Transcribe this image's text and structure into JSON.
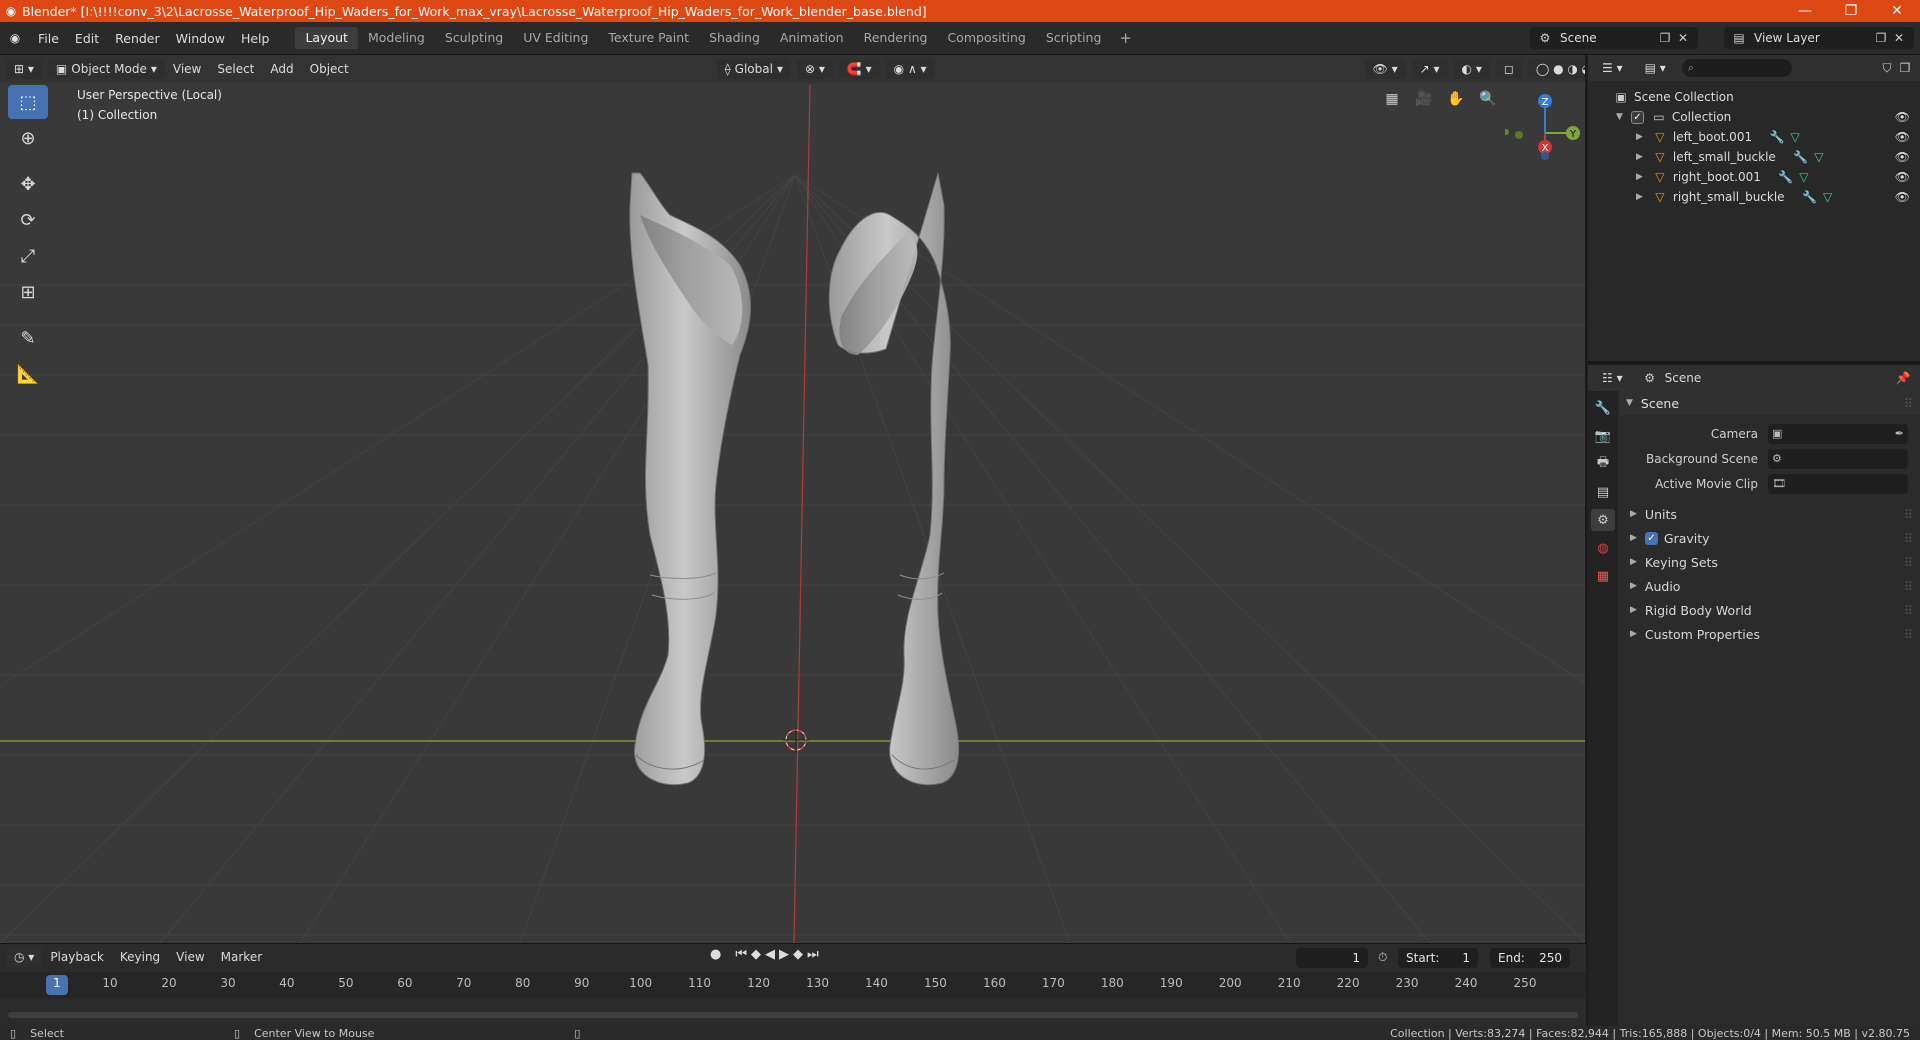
{
  "window": {
    "title": "Blender* [I:\\!!!!conv_3\\2\\Lacrosse_Waterproof_Hip_Waders_for_Work_max_vray\\Lacrosse_Waterproof_Hip_Waders_for_Work_blender_base.blend]",
    "minimize": "—",
    "maximize": "❐",
    "close": "✕"
  },
  "menu": {
    "items": [
      "File",
      "Edit",
      "Render",
      "Window",
      "Help"
    ],
    "workspaces": [
      "Layout",
      "Modeling",
      "Sculpting",
      "UV Editing",
      "Texture Paint",
      "Shading",
      "Animation",
      "Rendering",
      "Compositing",
      "Scripting"
    ],
    "active_workspace": "Layout",
    "add_workspace": "+",
    "scene_name": "Scene",
    "view_layer": "View Layer"
  },
  "viewport": {
    "mode": "Object Mode",
    "menus": [
      "View",
      "Select",
      "Add",
      "Object"
    ],
    "transform_orientation": "Global",
    "info_line1": "User Perspective (Local)",
    "info_line2": "(1) Collection",
    "gizmo": {
      "z": "Z",
      "y": "Y",
      "x": "X"
    },
    "colors": {
      "x_axis": "#c83a3a",
      "y_axis": "#7fa63a",
      "z_axis": "#2f7fd6",
      "bg": "#393939",
      "tool_active": "#4772b3"
    }
  },
  "tools": [
    "select-box",
    "cursor",
    "move",
    "rotate",
    "scale",
    "transform",
    "annotate",
    "measure"
  ],
  "timeline": {
    "menus": [
      "Playback",
      "Keying",
      "View",
      "Marker"
    ],
    "current_frame": "1",
    "start_label": "Start:",
    "start": "1",
    "end_label": "End:",
    "end": "250",
    "ticks": [
      "1",
      "10",
      "20",
      "30",
      "40",
      "50",
      "60",
      "70",
      "80",
      "90",
      "100",
      "110",
      "120",
      "130",
      "140",
      "150",
      "160",
      "170",
      "180",
      "190",
      "200",
      "210",
      "220",
      "230",
      "240",
      "250"
    ]
  },
  "statusbar": {
    "left": "Select",
    "middle": "Center View to Mouse",
    "stats": "Collection | Verts:83,274 | Faces:82,944 | Tris:165,888 | Objects:0/4 | Mem: 50.5 MB | v2.80.75"
  },
  "outliner": {
    "root": "Scene Collection",
    "collection": "Collection",
    "objects": [
      "left_boot.001",
      "left_small_buckle",
      "right_boot.001",
      "right_small_buckle"
    ]
  },
  "properties": {
    "context": "Scene",
    "panel_scene": "Scene",
    "camera_label": "Camera",
    "background_scene_label": "Background Scene",
    "active_movie_clip_label": "Active Movie Clip",
    "subpanels": [
      "Units",
      "Gravity",
      "Keying Sets",
      "Audio",
      "Rigid Body World",
      "Custom Properties"
    ]
  }
}
